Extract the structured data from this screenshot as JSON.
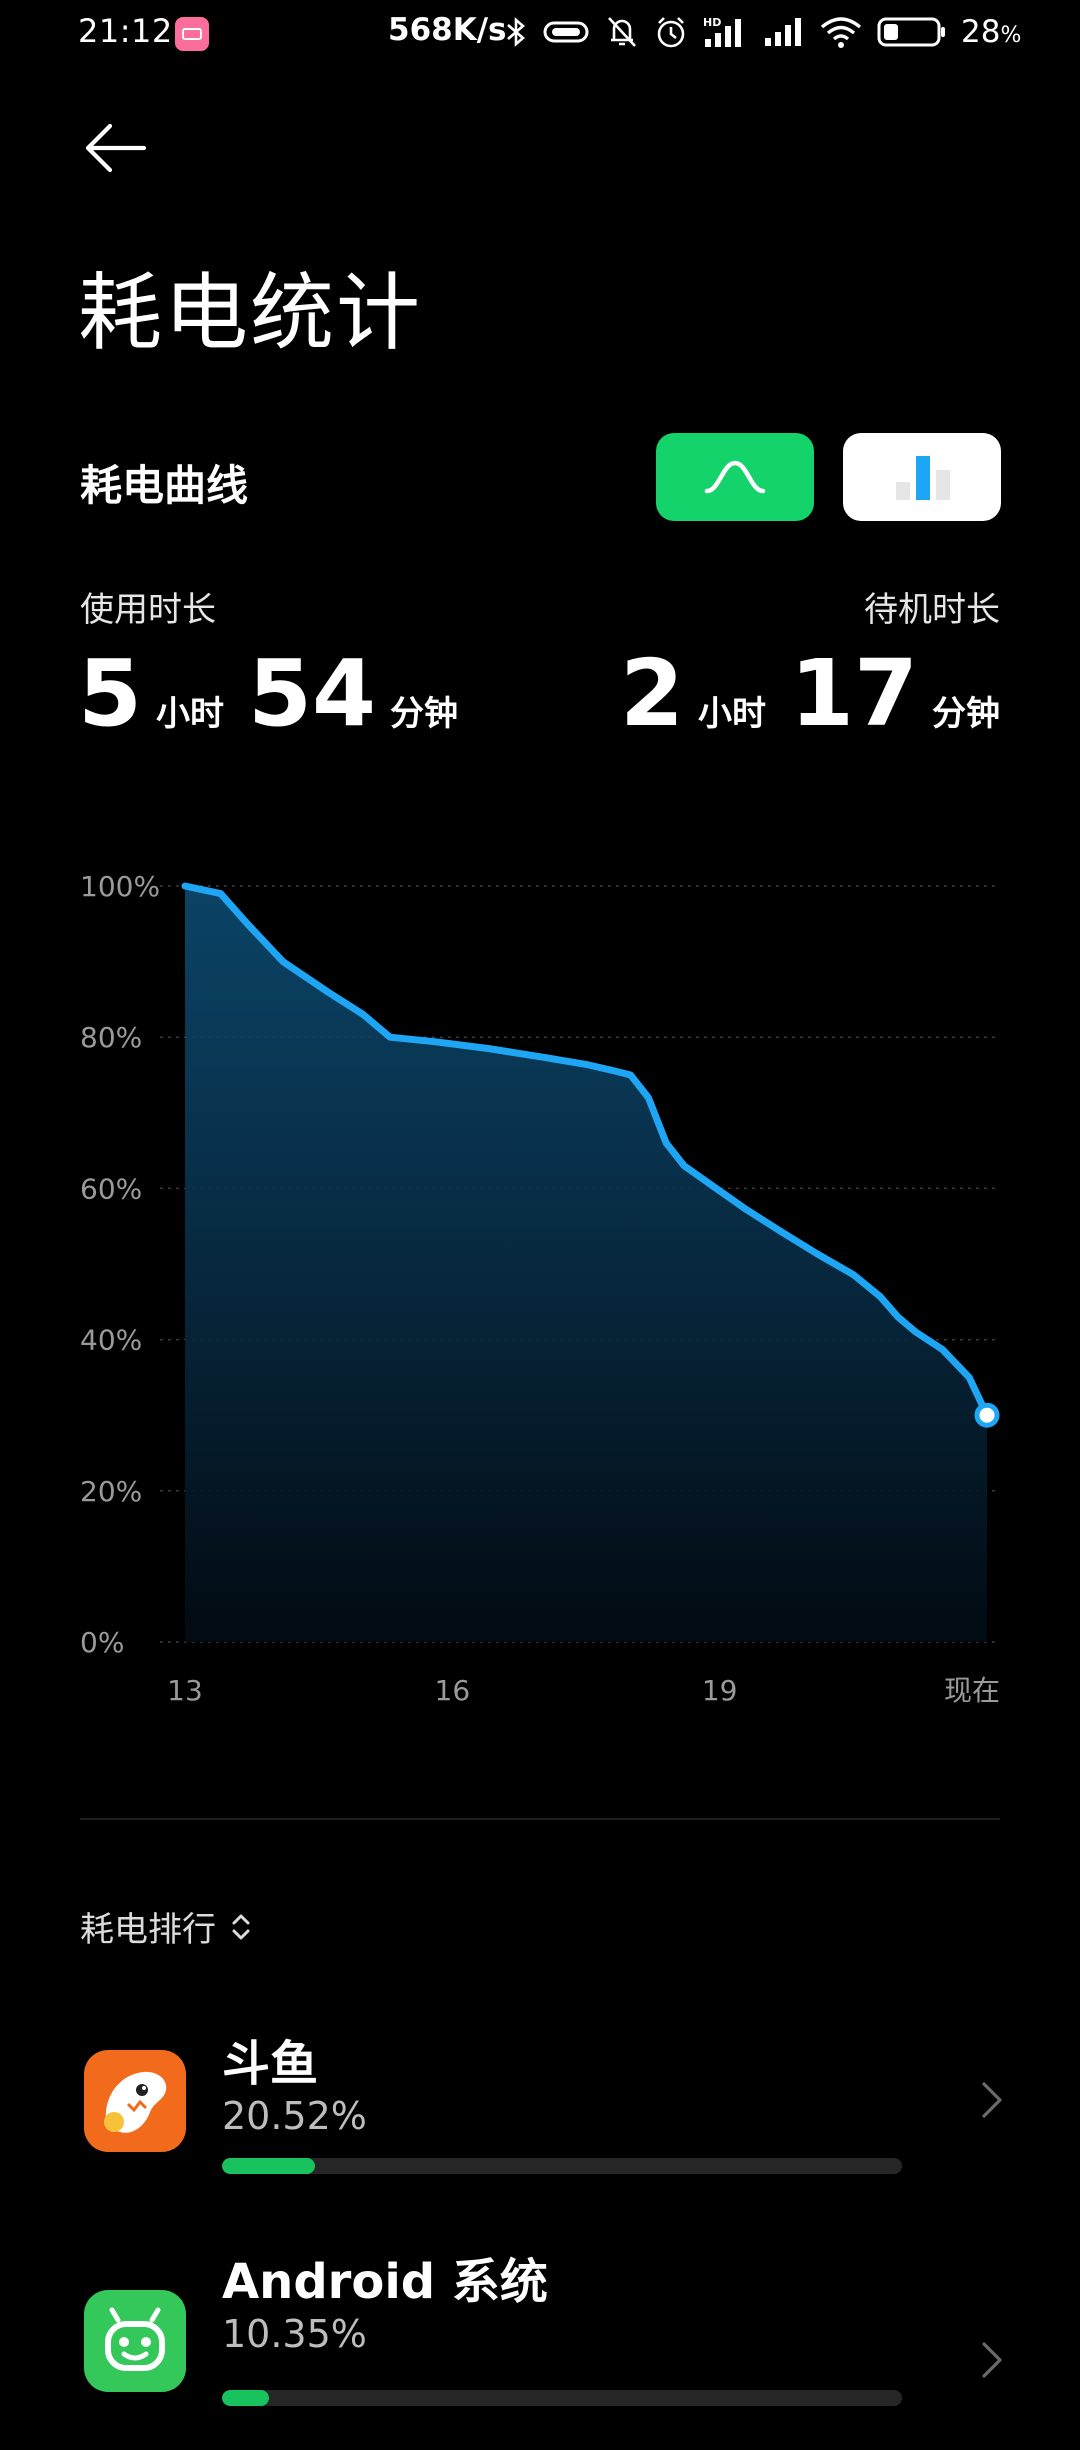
{
  "status_bar": {
    "time": "21:12",
    "speed": "568K/s",
    "battery_percent": "28",
    "battery_unit": "%",
    "battery_level": 0.28,
    "icons": [
      "app-notification-icon",
      "bluetooth-icon",
      "vibrate-icon",
      "mute-icon",
      "alarm-icon",
      "hd-signal-icon",
      "signal-icon",
      "wifi-icon",
      "battery-icon"
    ]
  },
  "header": {
    "back_icon": "back-arrow-icon",
    "title": "耗电统计"
  },
  "section": {
    "title": "耗电曲线",
    "toggle_curve_icon": "curve-chart-icon",
    "toggle_bar_icon": "bar-chart-icon",
    "active_toggle": "curve"
  },
  "usage": {
    "label": "使用时长",
    "hours": "5",
    "hours_unit": "小时",
    "minutes": "54",
    "minutes_unit": "分钟"
  },
  "standby": {
    "label": "待机时长",
    "hours": "2",
    "hours_unit": "小时",
    "minutes": "17",
    "minutes_unit": "分钟"
  },
  "colors": {
    "accent_green": "#14d36a",
    "chart_line": "#1ea6f5",
    "background": "#000000"
  },
  "chart_data": {
    "type": "area",
    "y_tick_labels": [
      "100%",
      "80%",
      "60%",
      "40%",
      "20%",
      "0%"
    ],
    "x_tick_labels": [
      "13",
      "16",
      "19",
      "现在"
    ],
    "x_tick_values": [
      13,
      16,
      19,
      22
    ],
    "ylim": [
      0,
      100
    ],
    "xlim": [
      13,
      22
    ],
    "grid": true,
    "series": [
      {
        "x": [
          13.0,
          13.4,
          13.7,
          14.1,
          14.6,
          15.0,
          15.3,
          15.8,
          16.4,
          17.0,
          17.5,
          17.8,
          18.0,
          18.2,
          18.3,
          18.4,
          18.6,
          18.9,
          19.3,
          19.7,
          20.1,
          20.5,
          20.8,
          21.0,
          21.2,
          21.5,
          21.8,
          22.0
        ],
        "y": [
          100,
          99,
          95,
          90,
          86,
          83,
          80,
          79.4,
          78.5,
          77.4,
          76.4,
          75.6,
          75.0,
          72.0,
          69.0,
          66.0,
          63.0,
          60.5,
          57.2,
          54.2,
          51.3,
          48.6,
          45.7,
          43.0,
          41.0,
          38.7,
          35.0,
          30
        ]
      }
    ]
  },
  "ranking": {
    "title": "耗电排行",
    "sort_icon": "sort-updown-icon",
    "items": [
      {
        "name": "斗鱼",
        "percent": "20.52%",
        "share": 0.1368,
        "icon": "douyu-icon"
      },
      {
        "name": "Android 系统",
        "percent": "10.35%",
        "share": 0.069,
        "icon": "android-icon"
      }
    ],
    "row_chevron_icon": "chevron-right-icon"
  }
}
